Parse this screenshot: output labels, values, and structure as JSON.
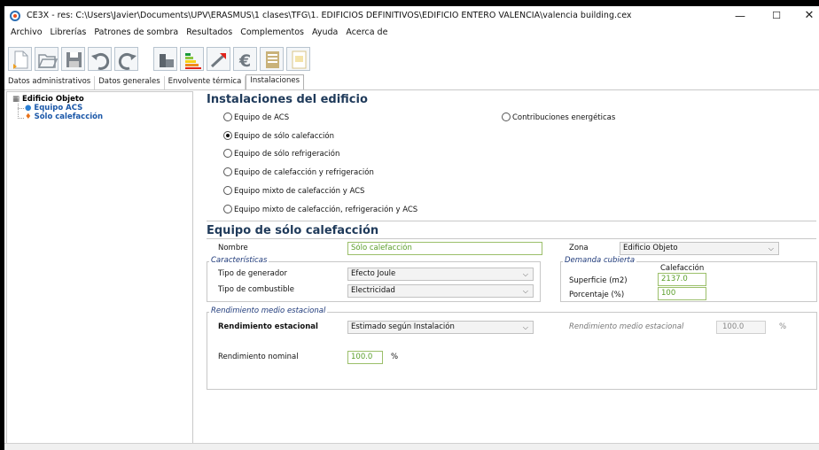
{
  "window": {
    "title": "CE3X - res: C:\\Users\\Javier\\Documents\\UPV\\ERASMUS\\1 clases\\TFG\\1. EDIFICIOS DEFINITIVOS\\EDIFICIO ENTERO VALENCIA\\valencia building.cex",
    "min_glyph": "—",
    "max_glyph": "☐",
    "close_glyph": "✕"
  },
  "menu": [
    "Archivo",
    "Librerías",
    "Patrones de sombra",
    "Resultados",
    "Complementos",
    "Ayuda",
    "Acerca de"
  ],
  "toolbar_icons": [
    "new-file-icon",
    "open-folder-icon",
    "save-icon",
    "undo-icon",
    "redo-icon",
    "building-icon",
    "energy-rating-icon",
    "chart-arrow-icon",
    "euro-icon",
    "report-icon",
    "certificate-icon"
  ],
  "tabs": [
    "Datos administrativos",
    "Datos generales",
    "Envolvente térmica",
    "Instalaciones"
  ],
  "tree": {
    "root": "Edificio Objeto",
    "children": [
      "Equipo ACS",
      "Sólo calefacción"
    ]
  },
  "installations": {
    "title": "Instalaciones del edificio",
    "options": [
      "Equipo de ACS",
      "Equipo de sólo calefacción",
      "Equipo de sólo refrigeración",
      "Equipo de calefacción y refrigeración",
      "Equipo mixto de calefacción y ACS",
      "Equipo mixto de calefacción, refrigeración y ACS",
      "Contribuciones energéticas"
    ],
    "selected": "Equipo de sólo calefacción"
  },
  "equipment": {
    "title": "Equipo de sólo calefacción",
    "nombre_label": "Nombre",
    "nombre_value": "Sólo calefacción",
    "zona_label": "Zona",
    "zona_value": "Edificio Objeto",
    "caracteristicas": {
      "title": "Características",
      "generador_label": "Tipo de generador",
      "generador_value": "Efecto Joule",
      "combustible_label": "Tipo de combustible",
      "combustible_value": "Electricidad"
    },
    "demanda": {
      "title": "Demanda cubierta",
      "column": "Calefacción",
      "superficie_label": "Superficie (m2)",
      "superficie_value": "2137.0",
      "porcentaje_label": "Porcentaje (%)",
      "porcentaje_value": "100"
    },
    "rendimiento": {
      "title": "Rendimiento medio estacional",
      "estacional_label": "Rendimiento estacional",
      "estacional_value": "Estimado según Instalación",
      "medio_label": "Rendimiento medio estacional",
      "medio_value": "100.0",
      "medio_unit": "%",
      "nominal_label": "Rendimiento nominal",
      "nominal_value": "100.0",
      "nominal_unit": "%"
    }
  },
  "colors": {
    "heading": "#1f3a5a",
    "field_text": "#5a9e2a",
    "tree_link": "#1a57a8"
  }
}
